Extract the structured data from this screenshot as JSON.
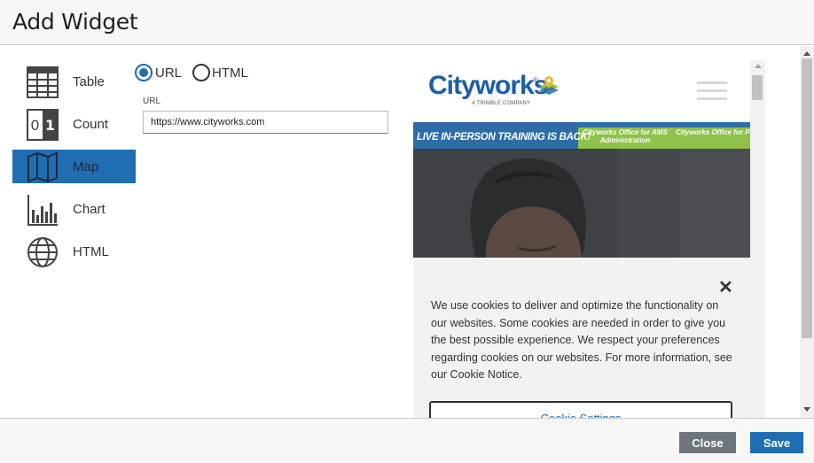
{
  "dialog": {
    "title": "Add Widget"
  },
  "widget_types": [
    {
      "label": "Table",
      "icon": "table-icon",
      "active": false
    },
    {
      "label": "Count",
      "icon": "count-icon",
      "active": false
    },
    {
      "label": "Map",
      "icon": "map-icon",
      "active": true
    },
    {
      "label": "Chart",
      "icon": "chart-icon",
      "active": false
    },
    {
      "label": "HTML",
      "icon": "globe-icon",
      "active": false
    }
  ],
  "source": {
    "options": [
      {
        "label": "URL",
        "checked": true
      },
      {
        "label": "HTML",
        "checked": false
      }
    ],
    "url_label": "URL",
    "url_value": "https://www.cityworks.com"
  },
  "count_icon": {
    "left_digit": "0",
    "right_digit": "1"
  },
  "preview": {
    "logo_text": "Cityworks",
    "logo_reg": "®",
    "logo_sub": "A TRIMBLE COMPANY",
    "banner_main": "LIVE IN-PERSON TRAINING IS BACK!",
    "banner_link_1": "Cityworks Office for AMS Administration",
    "banner_link_2": "Cityworks Office for PLL Administration",
    "cookie_close": "✕",
    "cookie_text": "We use cookies to deliver and optimize the functionality on our websites. Some cookies are needed in order to give you the best possible experience. We respect your preferences regarding cookies on our websites. For more information, see our Cookie Notice.",
    "cookie_button": "Cookie Settings"
  },
  "footer": {
    "close_label": "Close",
    "save_label": "Save"
  },
  "colors": {
    "accent": "#1f6db3",
    "close_button": "#6f757c",
    "banner_blue": "#2c6da8",
    "banner_green": "#8ec24a"
  }
}
